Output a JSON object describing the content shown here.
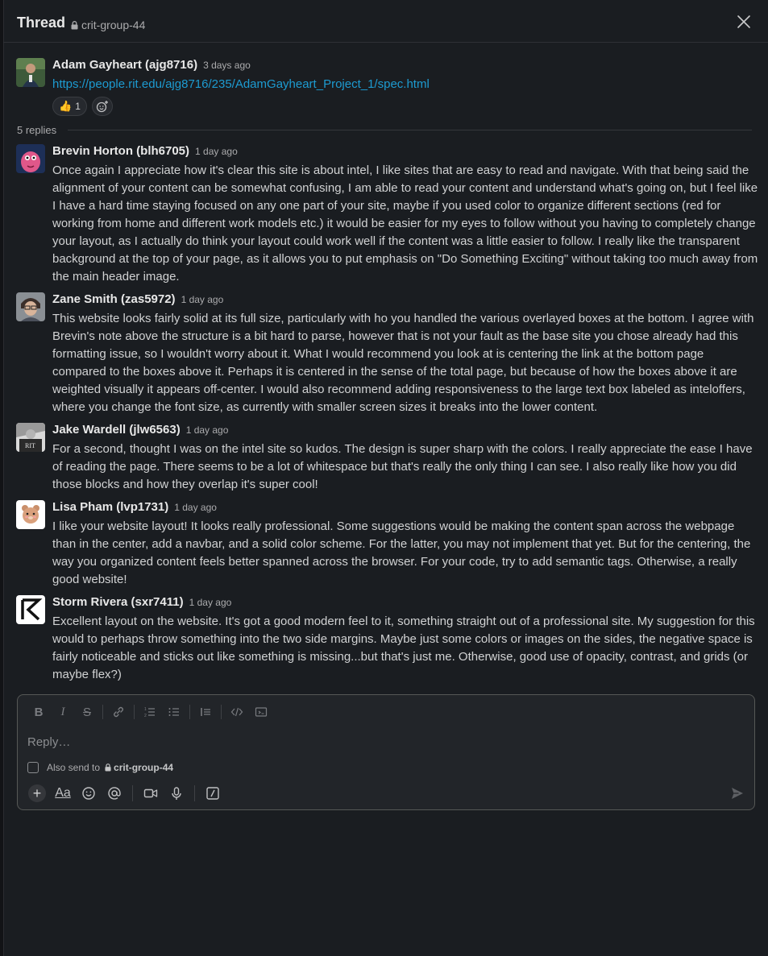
{
  "header": {
    "title": "Thread",
    "channel": "crit-group-44",
    "close_icon": "close-icon"
  },
  "parent": {
    "author": "Adam Gayheart (ajg8716)",
    "time": "3 days ago",
    "link": "https://people.rit.edu/ajg8716/235/AdamGayheart_Project_1/spec.html",
    "reaction": {
      "emoji": "👍",
      "count": "1"
    },
    "add_reaction_icon": "add-reaction-icon"
  },
  "replies_label": "5 replies",
  "replies": [
    {
      "author": "Brevin Horton (blh6705)",
      "time": "1 day ago",
      "text": "Once again I appreciate how it's clear this site is about intel, I like sites that are easy to read and navigate. With that being said the alignment of your content can be somewhat confusing, I am able to read your content and understand what's going on, but I feel like I have a hard time staying focused on any one part of your site, maybe if you used color to organize different sections (red for working from home and different work models etc.) it would be easier for my eyes to follow without you having to completely change your layout, as I actually do think your layout could work well if the content was a little easier to follow. I really like the transparent background at the top of your page, as it allows you to put emphasis on \"Do Something Exciting\" without taking too much away from the main header image."
    },
    {
      "author": "Zane Smith (zas5972)",
      "time": "1 day ago",
      "text": "This website looks fairly solid at its full size, particularly with ho you handled the various overlayed boxes at the bottom. I agree with Brevin's note above the structure is a bit hard to parse, however that is not your fault as the base site you chose already had this formatting issue, so I wouldn't worry about it. What I would recommend you look at is centering the link at the bottom page compared to the boxes above it. Perhaps it is centered in the sense of the total page, but because of how the boxes above it are weighted visually it appears off-center. I would also recommend adding responsiveness to the large text box labeled as inteloffers, where you change the font size, as currently with smaller screen sizes it breaks into the lower content."
    },
    {
      "author": "Jake Wardell (jlw6563)",
      "time": "1 day ago",
      "text": "For a second, thought I was on the intel site so kudos. The design is super sharp with the colors. I really appreciate the ease I have of reading the page. There seems to be a lot of whitespace but that's really the only thing I can see. I also really like how you did those blocks and how they overlap it's super cool!"
    },
    {
      "author": "Lisa Pham (lvp1731)",
      "time": "1 day ago",
      "text": "I like your website layout! It looks really professional. Some suggestions would be making the content span across the webpage than in the center, add a navbar, and a solid color scheme. For the latter, you may not implement that yet. But for the centering, the way you organized content feels better spanned across the browser. For your code, try to add semantic tags. Otherwise, a really good website!"
    },
    {
      "author": "Storm Rivera (sxr7411)",
      "time": "1 day ago",
      "text": "Excellent layout on the website. It's got a good modern feel to it, something straight out of a professional site. My suggestion for this would to perhaps throw something into the two side margins. Maybe just some colors or images on the sides, the negative space is fairly noticeable and sticks out like something is missing...but that's just me. Otherwise, good use of opacity, contrast, and grids (or maybe flex?)"
    }
  ],
  "composer": {
    "placeholder": "Reply…",
    "also_send_label": "Also send to",
    "also_send_channel": "crit-group-44",
    "format_icons": [
      "bold-icon",
      "italic-icon",
      "strikethrough-icon",
      "link-icon",
      "ordered-list-icon",
      "bulleted-list-icon",
      "blockquote-icon",
      "code-icon",
      "code-block-icon"
    ],
    "format_glyphs": {
      "bold": "B",
      "italic": "I",
      "strike": "S"
    },
    "text_format_label": "Aa"
  },
  "colors": {
    "background": "#1a1d21",
    "link": "#1d9bd1",
    "text": "#d1d2d3",
    "muted": "#ababad"
  }
}
